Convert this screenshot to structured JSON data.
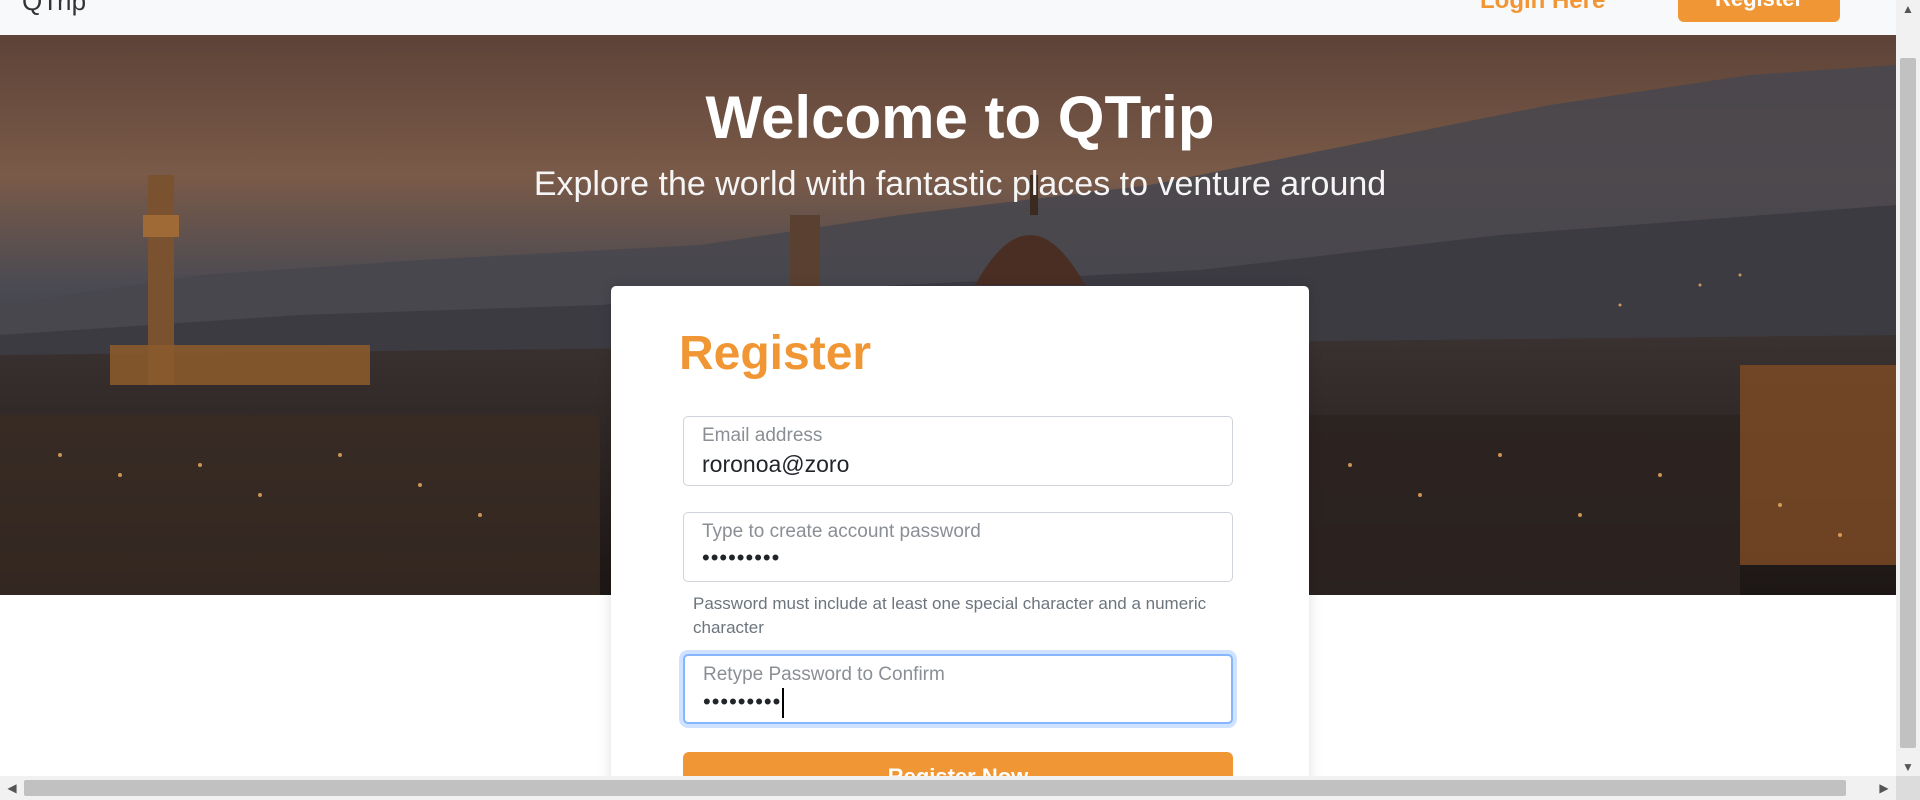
{
  "navbar": {
    "brand": "QTrip",
    "login_label": "Login Here",
    "register_label": "Register"
  },
  "hero": {
    "title": "Welcome to QTrip",
    "subtitle": "Explore the world with fantastic places to venture around"
  },
  "register_form": {
    "title": "Register",
    "email": {
      "label": "Email address",
      "value": "roronoa@zoro"
    },
    "password": {
      "label": "Type to create account password",
      "value": "•••••••••"
    },
    "password_hint": "Password must include at least one special character and a numeric character",
    "confirm_password": {
      "label": "Retype Password to Confirm",
      "value": "•••••••••"
    },
    "submit_label": "Register Now"
  },
  "colors": {
    "accent": "#f19634",
    "focus_ring": "#86b7fe",
    "text": "#212529",
    "muted": "#6c757d"
  },
  "icons": {
    "scroll_up": "chevron-up-icon",
    "scroll_down": "chevron-down-icon",
    "scroll_left": "chevron-left-icon",
    "scroll_right": "chevron-right-icon"
  }
}
